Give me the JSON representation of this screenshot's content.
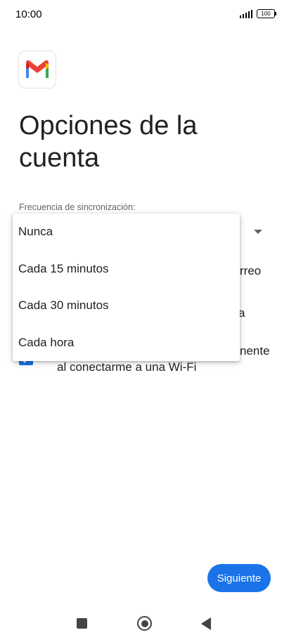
{
  "status_bar": {
    "time": "10:00",
    "battery": "100"
  },
  "app": {
    "logo_icon": "gmail-logo-icon"
  },
  "page": {
    "title": "Opciones de la cuenta",
    "sync_label": "Frecuencia de sincronización:"
  },
  "background_options": {
    "row1_fragment": "rreo",
    "row2_fragment": "a",
    "row3_fragment": "nente",
    "row3_line2": "al conectarme a una Wi-Fi",
    "checkbox_checked": true
  },
  "menu": {
    "items": [
      {
        "label": "Nunca"
      },
      {
        "label": "Cada 15 minutos"
      },
      {
        "label": "Cada 30 minutos"
      },
      {
        "label": "Cada hora"
      }
    ]
  },
  "actions": {
    "next_label": "Siguiente"
  },
  "colors": {
    "accent": "#1a73e8",
    "text": "#202124",
    "secondary_text": "#5f6368"
  }
}
